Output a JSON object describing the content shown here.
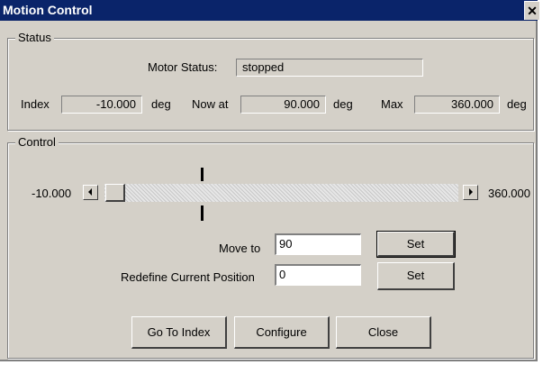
{
  "window": {
    "title": "Motion Control",
    "close_glyph": "✕"
  },
  "status": {
    "group_label": "Status",
    "motor_status_label": "Motor Status:",
    "motor_status_value": "stopped",
    "index_label": "Index",
    "index_value": "-10.000",
    "index_unit": "deg",
    "now_label": "Now at",
    "now_value": "90.000",
    "now_unit": "deg",
    "max_label": "Max",
    "max_value": "360.000",
    "max_unit": "deg"
  },
  "control": {
    "group_label": "Control",
    "slider_min_label": "-10.000",
    "slider_max_label": "360.000",
    "move_to_label": "Move to",
    "move_to_value": "90",
    "move_set_label": "Set",
    "redefine_label": "Redefine Current Position",
    "redefine_value": "0",
    "redefine_set_label": "Set"
  },
  "buttons": {
    "go_to_index": "Go To Index",
    "configure": "Configure",
    "close": "Close"
  },
  "icons": {
    "scroll_left": "scroll-left-arrow-icon",
    "scroll_right": "scroll-right-arrow-icon"
  },
  "colors": {
    "titlebar": "#0a246a",
    "face": "#d4d0c8"
  }
}
